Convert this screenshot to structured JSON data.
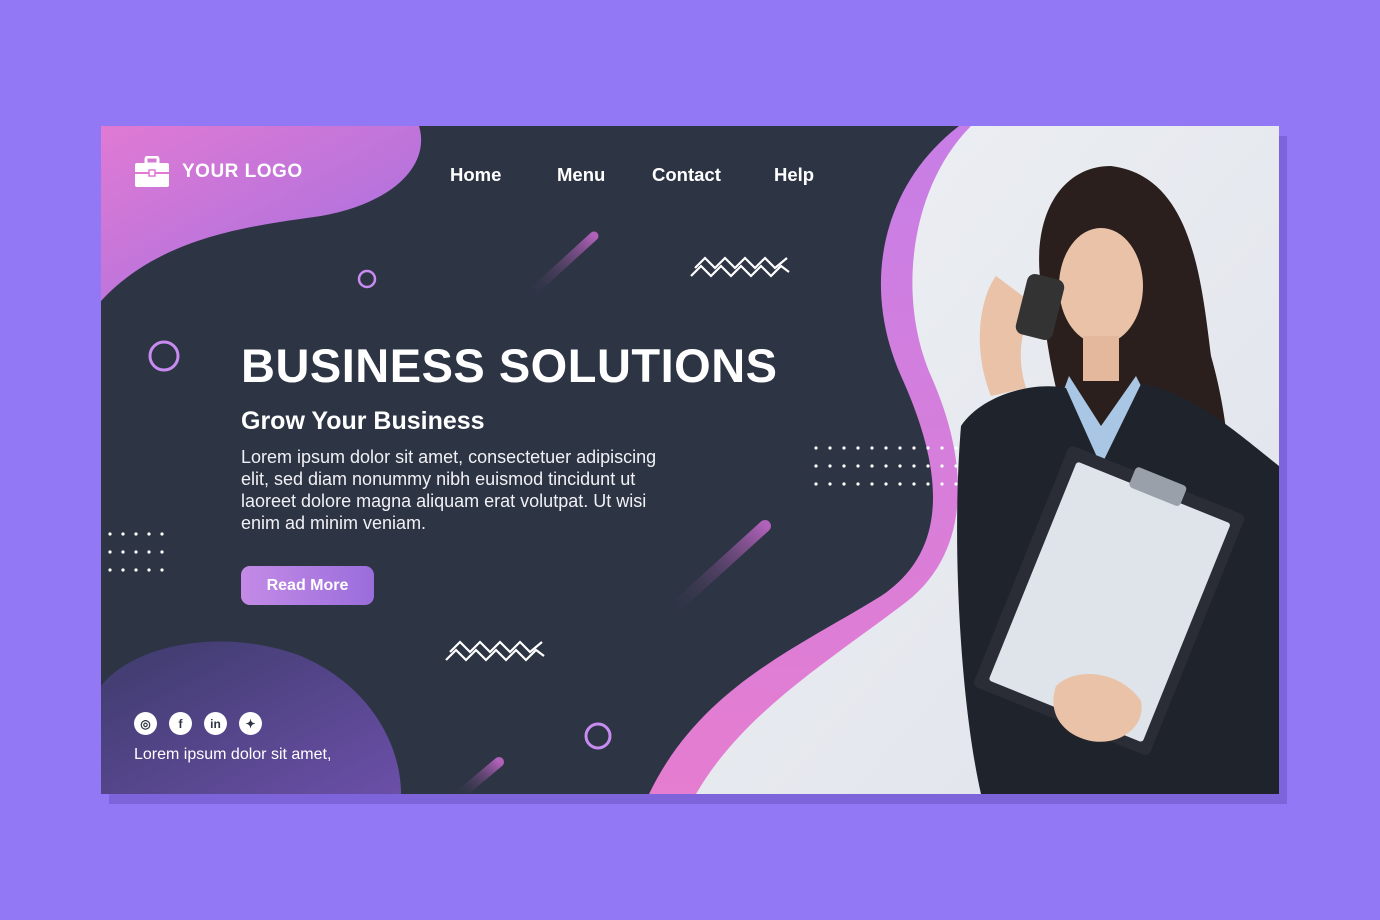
{
  "logo": {
    "text": "YOUR LOGO",
    "icon": "briefcase-icon"
  },
  "nav": [
    {
      "label": "Home"
    },
    {
      "label": "Menu"
    },
    {
      "label": "Contact"
    },
    {
      "label": "Help"
    }
  ],
  "hero": {
    "title": "BUSINESS SOLUTIONS",
    "subtitle": "Grow Your Business",
    "body": "Lorem ipsum dolor sit amet, consectetuer adipiscing elit, sed diam nonummy nibh euismod tincidunt ut laoreet dolore magna aliquam erat volutpat. Ut wisi enim ad minim veniam.",
    "cta_label": "Read More"
  },
  "socials": [
    {
      "icon": "instagram-icon",
      "glyph": "◎"
    },
    {
      "icon": "facebook-icon",
      "glyph": "f"
    },
    {
      "icon": "linkedin-icon",
      "glyph": "in"
    },
    {
      "icon": "twitter-icon",
      "glyph": "✦"
    }
  ],
  "footer": {
    "text": "Lorem ipsum dolor sit amet,"
  },
  "colors": {
    "page_background": "#9378f5",
    "card_background": "#2d3444",
    "accent_pink": "#e27ad0",
    "accent_purple": "#9a6ddc"
  }
}
